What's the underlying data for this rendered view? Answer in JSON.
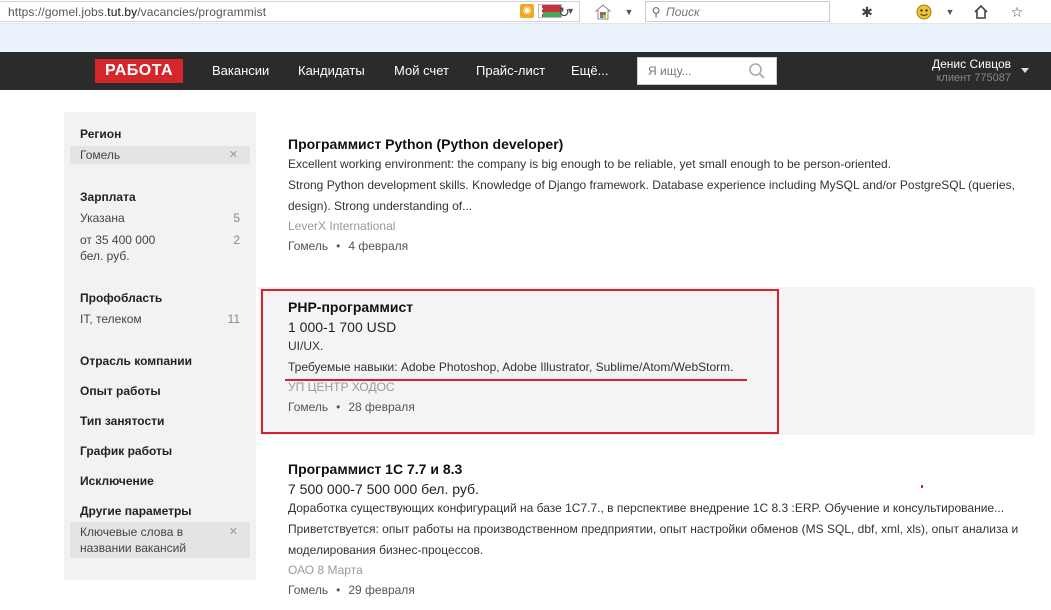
{
  "browser": {
    "url_prefix": "https://gomel.jobs.",
    "url_domain": "tut.by",
    "url_path": "/vacancies/programmist",
    "search_placeholder": "Поиск",
    "icons": [
      "rss-icon",
      "belarus-flag-icon",
      "reload-icon",
      "apps-icon",
      "search-icon",
      "bug-icon",
      "smiley-icon",
      "home-icon",
      "star-icon"
    ]
  },
  "nav": {
    "logo": "РАБОТА",
    "links": [
      "Вакансии",
      "Кандидаты",
      "Мой счет",
      "Прайс-лист",
      "Ещё..."
    ],
    "search_placeholder": "Я ищу...",
    "user_name": "Денис Сивцов",
    "user_client": "клиент 775087"
  },
  "sidebar": {
    "region": {
      "label": "Регион",
      "tag": "Гомель"
    },
    "salary": {
      "label": "Зарплата",
      "options": [
        {
          "label": "Указана",
          "count": "5"
        },
        {
          "label": "от 35 400 000 бел. руб.",
          "count": "2"
        }
      ]
    },
    "profarea": {
      "label": "Профобласть",
      "options": [
        {
          "label": "IT, телеком",
          "count": "11"
        }
      ]
    },
    "more_filters": [
      "Отрасль компании",
      "Опыт работы",
      "Тип занятости",
      "График работы",
      "Исключение"
    ],
    "other": {
      "label": "Другие параметры",
      "tag": "Ключевые слова в названии ваканcий"
    }
  },
  "vacancies": [
    {
      "title": "Программист Python (Python developer)",
      "lines": [
        "Excellent working environment: the company is big enough to be reliable, yet small enough to be person-oriented.",
        "Strong Python development skills. Knowledge of Django framework. Database experience including MySQL and/or PostgreSQL (queries, design). Strong understanding of..."
      ],
      "company": "LeverX International",
      "city": "Гомель",
      "date": "4 февраля"
    },
    {
      "title": "PHP-программист",
      "salary": "1 000-1 700 USD",
      "lines": [
        "UI/UX.",
        "Требуемые навыки: Adobe Photoshop, Adobe Illustrator, Sublime/Atom/WebStorm."
      ],
      "company": "УП ЦЕНТР ХОДОС",
      "city": "Гомель",
      "date": "28 февраля"
    },
    {
      "title": "Программист 1С 7.7 и 8.3",
      "salary": "7 500 000-7 500 000 бел. руб.",
      "lines": [
        "Доработка существующих конфигураций на базе 1С7.7., в перспективе внедрение 1С 8.3 :ERP. Обучение и консультирование...",
        "Приветствуется: опыт работы на производственном предприятии, опыт настройки обменов (MS SQL, dbf, xml, xls), опыт анализа и моделирования бизнес-процессов."
      ],
      "company": "ОАО 8 Марта",
      "city": "Гомель",
      "date": "29 февраля"
    }
  ],
  "colors": {
    "accent": "#d5262b",
    "nav_bg": "#2b2b2b",
    "highlight": "#d6202c"
  }
}
